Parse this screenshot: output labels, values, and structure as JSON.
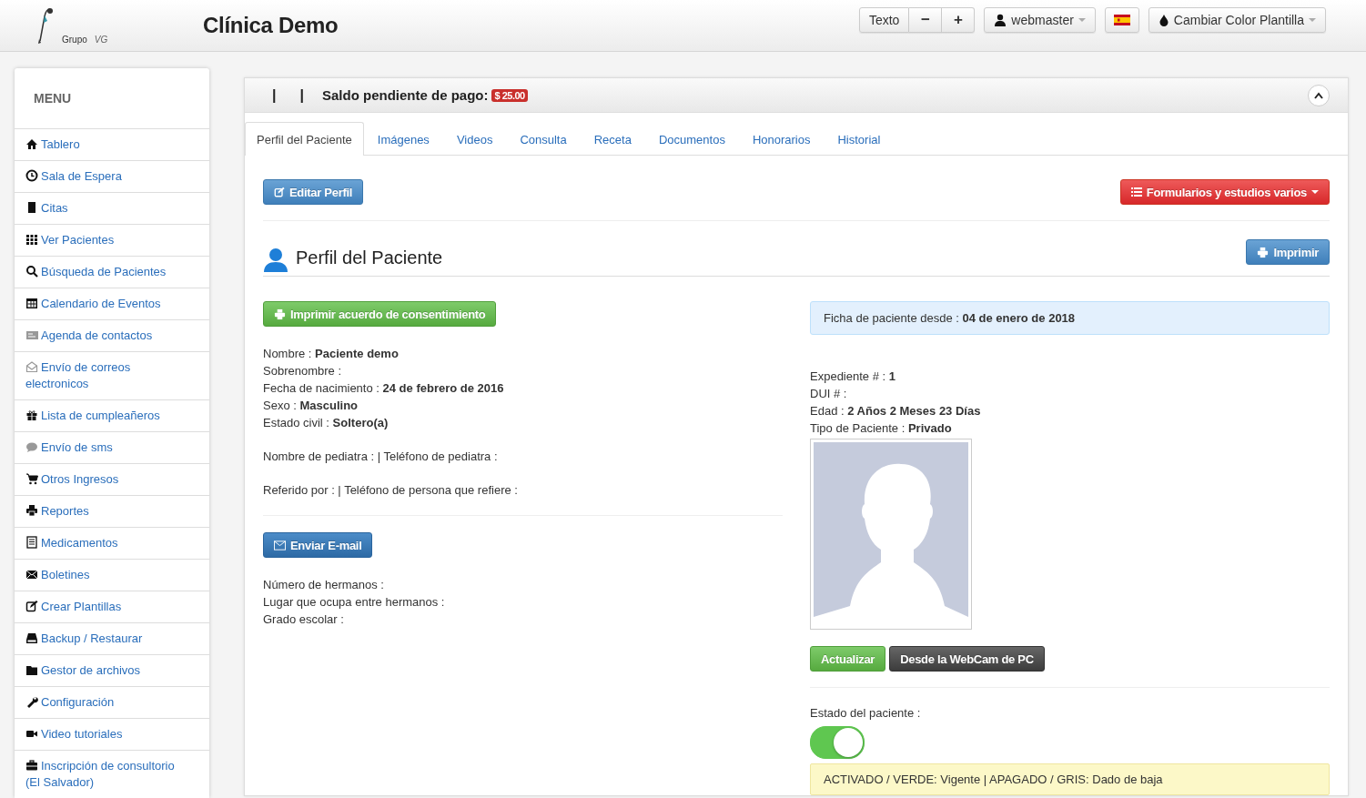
{
  "header": {
    "logo_words": [
      "Grupo",
      "VG"
    ],
    "title": "Clínica Demo",
    "text_size": {
      "label": "Texto",
      "decrease": "−",
      "increase": "+"
    },
    "user": "webmaster",
    "color_button": "Cambiar Color Plantilla"
  },
  "sidebar": {
    "heading": "MENU",
    "items": [
      {
        "label": "Tablero"
      },
      {
        "label": "Sala de Espera"
      },
      {
        "label": "Citas"
      },
      {
        "label": "Ver Pacientes"
      },
      {
        "label": "Búsqueda de Pacientes"
      },
      {
        "label": "Calendario de Eventos"
      },
      {
        "label": "Agenda de contactos"
      },
      {
        "label": "Envío de correos electronicos"
      },
      {
        "label": "Lista de cumpleañeros"
      },
      {
        "label": "Envío de sms"
      },
      {
        "label": "Otros Ingresos"
      },
      {
        "label": "Reportes"
      },
      {
        "label": "Medicamentos"
      },
      {
        "label": "Boletines"
      },
      {
        "label": "Crear Plantillas"
      },
      {
        "label": "Backup / Restaurar"
      },
      {
        "label": "Gestor de archivos"
      },
      {
        "label": "Configuración"
      },
      {
        "label": "Video tutoriales"
      },
      {
        "label": "Inscripción de consultorio (El Salvador)"
      }
    ]
  },
  "panel": {
    "separators": [
      "|",
      "|"
    ],
    "balance_label": "Saldo pendiente de pago:",
    "balance": "$ 25.00",
    "tabs": [
      {
        "label": "Perfil del Paciente",
        "selected": true
      },
      {
        "label": "Imágenes",
        "selected": false
      },
      {
        "label": "Videos",
        "selected": false
      },
      {
        "label": "Consulta",
        "selected": false
      },
      {
        "label": "Receta",
        "selected": false
      },
      {
        "label": "Documentos",
        "selected": false
      },
      {
        "label": "Honorarios",
        "selected": false
      },
      {
        "label": "Historial",
        "selected": false
      }
    ],
    "edit_button": "Editar Perfil",
    "forms_button": "Formularios y estudios varios",
    "section_title": "Perfil del Paciente",
    "print_button": "Imprimir",
    "consent_button": "Imprimir acuerdo de consentimiento",
    "personal": [
      "Nombre : **Paciente demo**",
      "Sobrenombre :",
      "Fecha de nacimiento : **24 de febrero de 2016**",
      "Sexo : **Masculino**",
      "Estado civil : **Soltero(a)**"
    ],
    "pediatrician": "Nombre de pediatra : | Teléfono de pediatra :",
    "referral": "Referido por : | Teléfono de persona que refiere :",
    "email_button": "Enviar E-mail",
    "siblings": [
      "Número de hermanos :",
      "Lugar que ocupa entre hermanos :",
      "Grado escolar :"
    ],
    "record_since": "Ficha de paciente desde : **04 de enero de 2018**",
    "record": [
      "Expediente # : **1**",
      "DUI # :",
      "Edad : **2 Años 2 Meses 23 Días**",
      "Tipo de Paciente : **Privado**"
    ],
    "update_button": "Actualizar",
    "webcam_button": "Desde la WebCam de PC",
    "status_label": "Estado del paciente :",
    "status_on": true,
    "legend": "ACTIVADO / VERDE: Vigente | APAGADO / GRIS: Dado de baja"
  }
}
